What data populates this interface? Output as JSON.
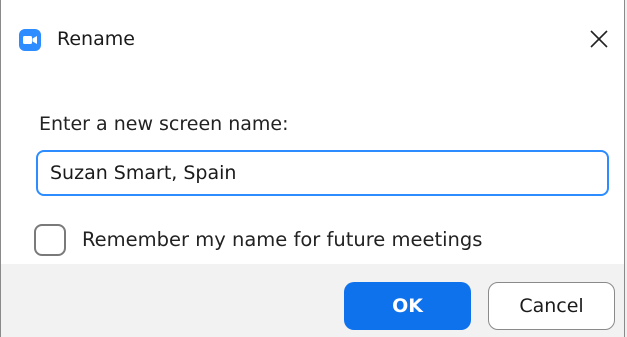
{
  "window": {
    "title": "Rename",
    "app_icon": "video-camera-icon",
    "close_icon": "close-icon"
  },
  "form": {
    "prompt": "Enter a new screen name:",
    "name_value": "Suzan Smart, Spain",
    "remember_label": "Remember my name for future meetings",
    "remember_checked": false
  },
  "buttons": {
    "ok_label": "OK",
    "cancel_label": "Cancel"
  },
  "colors": {
    "accent": "#0e72ed",
    "app_icon": "#2d8cff",
    "input_focus_border": "#2d8cff",
    "footer_bg": "#f2f2f2"
  }
}
